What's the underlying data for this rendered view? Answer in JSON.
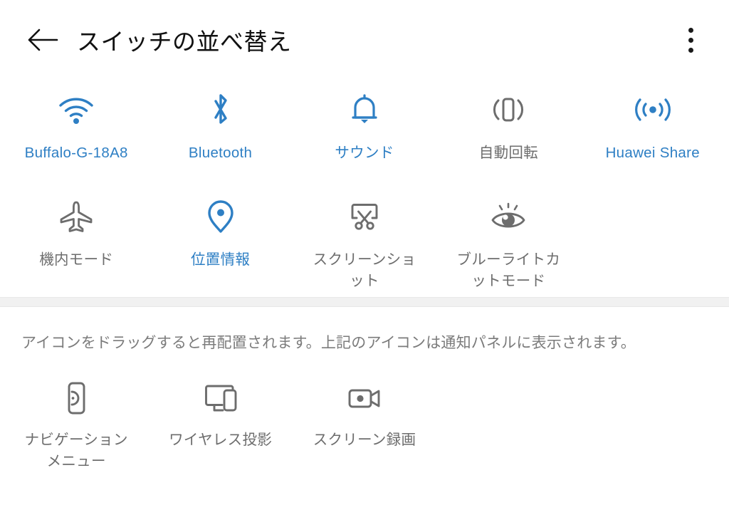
{
  "header": {
    "title": "スイッチの並べ替え",
    "back_icon": "arrow-left-icon",
    "menu_icon": "more-vertical-icon"
  },
  "colors": {
    "active": "#2e7fc4",
    "inactive": "#6d6d6d",
    "background": "#ffffff",
    "band": "#f1f1f1",
    "title": "#111111",
    "hint": "#7b7b7b"
  },
  "active_switches": {
    "rows": [
      [
        {
          "label": "Buffalo-G-18A8",
          "icon": "wifi-icon",
          "state": "on"
        },
        {
          "label": "Bluetooth",
          "icon": "bluetooth-icon",
          "state": "on"
        },
        {
          "label": "サウンド",
          "icon": "bell-icon",
          "state": "on"
        },
        {
          "label": "自動回転",
          "icon": "auto-rotate-icon",
          "state": "off"
        },
        {
          "label": "Huawei Share",
          "icon": "huawei-share-icon",
          "state": "on"
        }
      ],
      [
        {
          "label": "機内モード",
          "icon": "airplane-icon",
          "state": "off"
        },
        {
          "label": "位置情報",
          "icon": "location-pin-icon",
          "state": "on"
        },
        {
          "label": "スクリーンショット",
          "icon": "screenshot-scissors-icon",
          "state": "off"
        },
        {
          "label": "ブルーライトカットモード",
          "icon": "eye-comfort-icon",
          "state": "off"
        }
      ]
    ]
  },
  "hint": {
    "text": "アイコンをドラッグすると再配置されます。上記のアイコンは通知パネルに表示されます。"
  },
  "hidden_switches": {
    "items": [
      {
        "label": "ナビゲーションメニュー",
        "icon": "navigation-menu-icon",
        "state": "off"
      },
      {
        "label": "ワイヤレス投影",
        "icon": "wireless-projection-icon",
        "state": "off"
      },
      {
        "label": "スクリーン録画",
        "icon": "screen-record-icon",
        "state": "off"
      }
    ]
  }
}
